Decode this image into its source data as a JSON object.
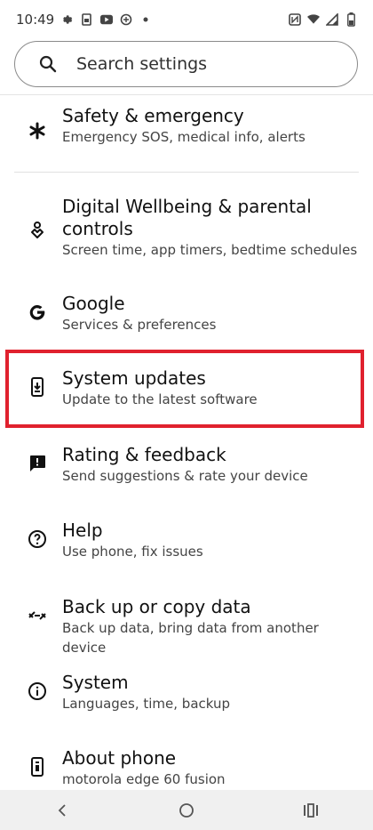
{
  "status_bar": {
    "time": "10:49",
    "left_icons": [
      "gear-icon",
      "sim-icon",
      "youtube-icon",
      "sync-icon",
      "dot-icon"
    ],
    "right_icons": [
      "nfc-icon",
      "wifi-icon",
      "signal-icon",
      "battery-icon"
    ]
  },
  "search": {
    "placeholder": "Search settings",
    "icon": "search-icon"
  },
  "items": [
    {
      "title": "Safety & emergency",
      "subtitle": "Emergency SOS, medical info, alerts",
      "icon": "asterisk-icon"
    },
    {
      "title_line1": "Digital Wellbeing & parental",
      "title_line2": "controls",
      "subtitle": "Screen time, app timers, bedtime schedules",
      "icon": "wellbeing-icon"
    },
    {
      "title": "Google",
      "subtitle": "Services & preferences",
      "icon": "google-icon"
    },
    {
      "title": "System updates",
      "subtitle": "Update to the latest software",
      "icon": "system-update-icon"
    },
    {
      "title": "Rating & feedback",
      "subtitle": "Send suggestions & rate your device",
      "icon": "feedback-icon"
    },
    {
      "title": "Help",
      "subtitle": "Use phone, fix issues",
      "icon": "help-icon"
    },
    {
      "title": "Back up or copy data",
      "subtitle": "Back up data, bring data from another device",
      "icon": "backup-icon"
    },
    {
      "title": "System",
      "subtitle": "Languages, time, backup",
      "icon": "info-icon"
    },
    {
      "title": "About phone",
      "subtitle": "motorola edge 60 fusion",
      "icon": "phone-icon"
    }
  ],
  "highlight_color": "#e0212e",
  "nav": [
    "back-icon",
    "home-icon",
    "recents-icon"
  ]
}
